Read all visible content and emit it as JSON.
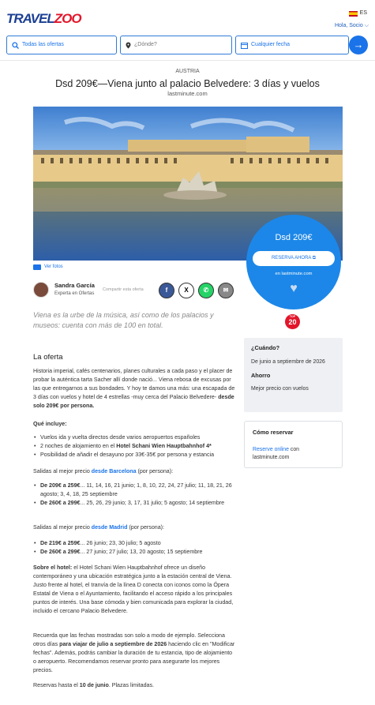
{
  "header": {
    "logo_main": "TRAVEL",
    "logo_accent": "ZOO",
    "lang": "ES",
    "user_greeting": "Hola, Socio"
  },
  "search": {
    "deals_label": "Todas las ofertas",
    "where_placeholder": "¿Dónde?",
    "date_label": "Cualquier fecha"
  },
  "deal": {
    "country": "AUSTRIA",
    "title": "Dsd 209€—Viena junto al palacio Belvedere: 3 días y vuelos",
    "provider": "lastminute.com",
    "price": "Dsd 209€",
    "reserve_label": "RESERVA AHORA",
    "on_label": "en lastminute.com",
    "photos_label": "Ver fotos"
  },
  "author": {
    "name": "Sandra García",
    "role": "Experta en Ofertas",
    "share_label": "Compartir esta oferta"
  },
  "intro": "Viena es la urbe de la música, así como de los palacios y museos: cuenta con más de 100 en total.",
  "badge": {
    "top": "TOP",
    "num": "20"
  },
  "sidebar": {
    "when_label": "¿Cuándo?",
    "when_value": "De junio a septiembre de 2026",
    "save_label": "Ahorro",
    "save_value": "Mejor precio con vuelos",
    "book_label": "Cómo reservar",
    "book_link": "Reserve online",
    "book_rest": " con lastminute.com"
  },
  "offer": {
    "heading": "La oferta",
    "p1": "Historia imperial, cafés centenarios, planes culturales a cada paso y el placer de probar la auténtica tarta Sacher allí donde nació... Viena rebosa de excusas por las que entregarnos a sus bondades. Y hoy te damos una más: una escapada de 3 días con vuelos y hotel de 4 estrellas -muy cerca del Palacio Belvedere-",
    "p1_bold": " desde solo 209€ por persona.",
    "includes_label": "Qué incluye:",
    "inc1": "Vuelos ida y vuelta directos desde varios aeropuertos españoles",
    "inc2_a": "2 noches de alojamiento en el ",
    "inc2_b": "Hotel Schani Wien Hauptbahnhof 4*",
    "inc3": "Posibilidad de añadir el desayuno por 33€-35€ por persona y estancia",
    "bcn_a": "Salidas al mejor precio ",
    "bcn_link": "desde Barcelona",
    "bcn_b": " (por persona):",
    "bcn1_b": "De 209€ a 259€",
    "bcn1": "... 11, 14, 16, 21 junio; 1, 8, 10, 22, 24, 27 julio; 11, 18, 21, 26 agosto; 3, 4, 18, 25 septiembre",
    "bcn2_b": "De 260€ a 299€",
    "bcn2": "... 25, 26, 29 junio; 3, 17, 31 julio; 5 agosto; 14 septiembre",
    "mad_a": "Salidas al mejor precio ",
    "mad_link": "desde Madrid",
    "mad_b": " (por persona):",
    "mad1_b": "De 219€ a 259€",
    "mad1": "... 26 junio; 23, 30 julio; 5 agosto",
    "mad2_b": "De 260€ a 299€",
    "mad2": "... 27 junio; 27 julio; 13, 20 agosto; 15 septiembre",
    "hotel_b": "Sobre el hotel:",
    "hotel": " el Hotel Schani Wien Hauptbahnhof ofrece un diseño contemporáneo y una ubicación estratégica junto a la estación central de Viena. Justo frente al hotel, el tranvía de la línea D conecta con iconos como la Ópera Estatal de Viena o el Ayuntamiento, facilitando el acceso rápido a los principales puntos de interés. Una base cómoda y bien comunicada para explorar la ciudad, incluido el cercano Palacio Belvedere.",
    "dates_a": "Recuerda que las fechas mostradas son solo a modo de ejemplo. Selecciona otros días ",
    "dates_b": "para viajar de julio a septiembre de 2026",
    "dates_c": " haciendo clic en \"Modificar fechas\". Además, podrás cambiar la duración de tu estancia, tipo de alojamiento o aeropuerto. Recomendamos reservar pronto para asegurarte los mejores precios.",
    "until_a": "Reservas hasta el ",
    "until_b": "10 de junio",
    "until_c": ". Plazas limitadas."
  }
}
